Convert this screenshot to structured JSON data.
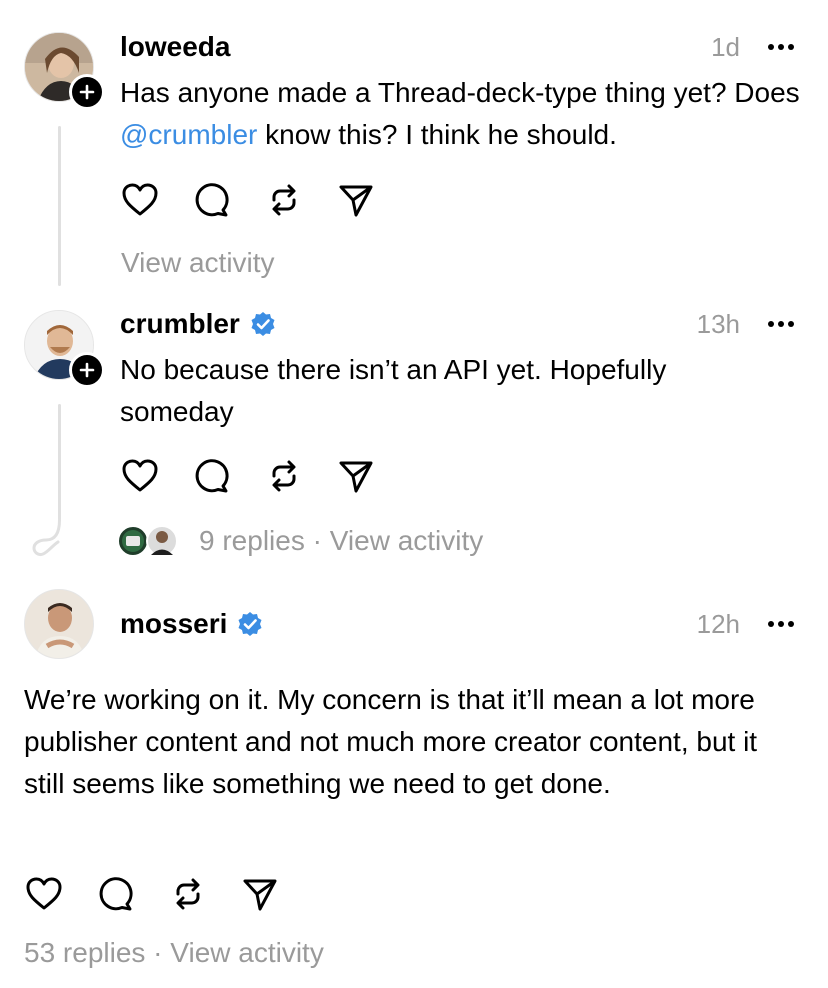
{
  "posts": [
    {
      "username": "loweeda",
      "time": "1d",
      "text_before": "Has anyone made a Thread-deck-type thing yet? Does ",
      "mention": "@crumbler",
      "text_after": " know this? I think he should.",
      "meta": "View activity"
    },
    {
      "username": "crumbler",
      "verified": true,
      "time": "13h",
      "text": "No because there isn’t an API yet. Hopefully someday",
      "meta_replies": "9 replies",
      "meta_sep": " · ",
      "meta_activity": "View activity"
    },
    {
      "username": "mosseri",
      "verified": true,
      "time": "12h",
      "text": "We’re working on it. My concern is that it’ll mean a lot more publisher content and not much more creator content, but it still seems like something we need to get done.",
      "meta_replies": "53 replies",
      "meta_sep": " · ",
      "meta_activity": "View activity"
    }
  ],
  "colors": {
    "link": "#3b8de3",
    "verified": "#3b8de3",
    "muted": "#9a9a9a",
    "thread_line": "#e0e0e0"
  },
  "icons": [
    "heart-icon",
    "comment-icon",
    "repost-icon",
    "send-icon",
    "more-icon",
    "plus-icon",
    "verified-badge-icon"
  ]
}
